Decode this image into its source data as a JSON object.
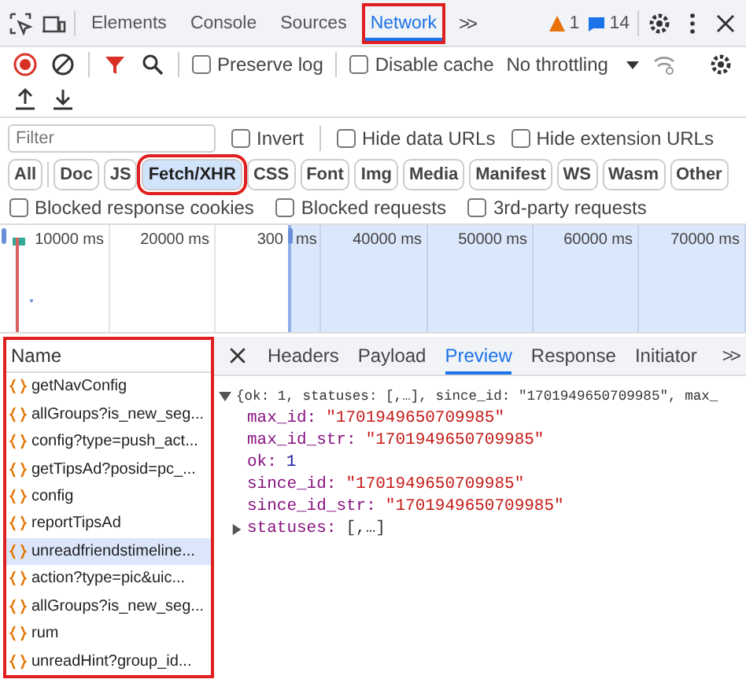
{
  "top_tabs": [
    {
      "label": "Elements",
      "selected": false,
      "highlighted": false
    },
    {
      "label": "Console",
      "selected": false,
      "highlighted": false
    },
    {
      "label": "Sources",
      "selected": false,
      "highlighted": false
    },
    {
      "label": "Network",
      "selected": true,
      "highlighted": true
    }
  ],
  "more_tabs": ">>",
  "warnings": "1",
  "messages": "14",
  "toolbar": {
    "preserve_log": {
      "label": "Preserve log",
      "checked": false
    },
    "disable_cache": {
      "label": "Disable cache",
      "checked": false
    },
    "throttling": "No throttling"
  },
  "filter": {
    "placeholder": "Filter",
    "options": [
      {
        "label": "Invert",
        "checked": false
      },
      {
        "label": "Hide data URLs",
        "checked": false
      },
      {
        "label": "Hide extension URLs",
        "checked": false
      }
    ]
  },
  "types": [
    {
      "label": "All",
      "selected": false,
      "highlighted": false
    },
    {
      "label": "Doc",
      "selected": false,
      "highlighted": false
    },
    {
      "label": "JS",
      "selected": false,
      "highlighted": false
    },
    {
      "label": "Fetch/XHR",
      "selected": true,
      "highlighted": true
    },
    {
      "label": "CSS",
      "selected": false,
      "highlighted": false
    },
    {
      "label": "Font",
      "selected": false,
      "highlighted": false
    },
    {
      "label": "Img",
      "selected": false,
      "highlighted": false
    },
    {
      "label": "Media",
      "selected": false,
      "highlighted": false
    },
    {
      "label": "Manifest",
      "selected": false,
      "highlighted": false
    },
    {
      "label": "WS",
      "selected": false,
      "highlighted": false
    },
    {
      "label": "Wasm",
      "selected": false,
      "highlighted": false
    },
    {
      "label": "Other",
      "selected": false,
      "highlighted": false
    }
  ],
  "blocked_options": [
    {
      "label": "Blocked response cookies",
      "checked": false
    },
    {
      "label": "Blocked requests",
      "checked": false
    },
    {
      "label": "3rd-party requests",
      "checked": false
    }
  ],
  "timeline_ticks": [
    "10000 ms",
    "20000 ms",
    "300",
    "ms",
    "40000 ms",
    "50000 ms",
    "60000 ms",
    "70000 ms"
  ],
  "name_panel": {
    "header": "Name",
    "highlighted": true,
    "rows": [
      {
        "name": "getNavConfig",
        "selected": false
      },
      {
        "name": "allGroups?is_new_seg...",
        "selected": false
      },
      {
        "name": "config?type=push_act...",
        "selected": false
      },
      {
        "name": "getTipsAd?posid=pc_...",
        "selected": false
      },
      {
        "name": "config",
        "selected": false
      },
      {
        "name": "reportTipsAd",
        "selected": false
      },
      {
        "name": "unreadfriendstimeline...",
        "selected": true
      },
      {
        "name": "action?type=pic&uic...",
        "selected": false
      },
      {
        "name": "allGroups?is_new_seg...",
        "selected": false
      },
      {
        "name": "rum",
        "selected": false
      },
      {
        "name": "unreadHint?group_id...",
        "selected": false
      }
    ]
  },
  "detail_tabs": [
    {
      "label": "Headers",
      "selected": false
    },
    {
      "label": "Payload",
      "selected": false
    },
    {
      "label": "Preview",
      "selected": true
    },
    {
      "label": "Response",
      "selected": false
    },
    {
      "label": "Initiator",
      "selected": false
    }
  ],
  "detail_more": ">>",
  "preview": {
    "summary": "{ok: 1, statuses: [,…], since_id: \"1701949650709985\", max_",
    "expanded": true,
    "properties": [
      {
        "key": "max_id:",
        "value": "\"1701949650709985\"",
        "kind": "string"
      },
      {
        "key": "max_id_str:",
        "value": "\"1701949650709985\"",
        "kind": "string"
      },
      {
        "key": "ok:",
        "value": "1",
        "kind": "number"
      },
      {
        "key": "since_id:",
        "value": "\"1701949650709985\"",
        "kind": "string"
      },
      {
        "key": "since_id_str:",
        "value": "\"1701949650709985\"",
        "kind": "string"
      },
      {
        "key": "statuses:",
        "value": "[,…]",
        "kind": "collapsed"
      }
    ]
  }
}
